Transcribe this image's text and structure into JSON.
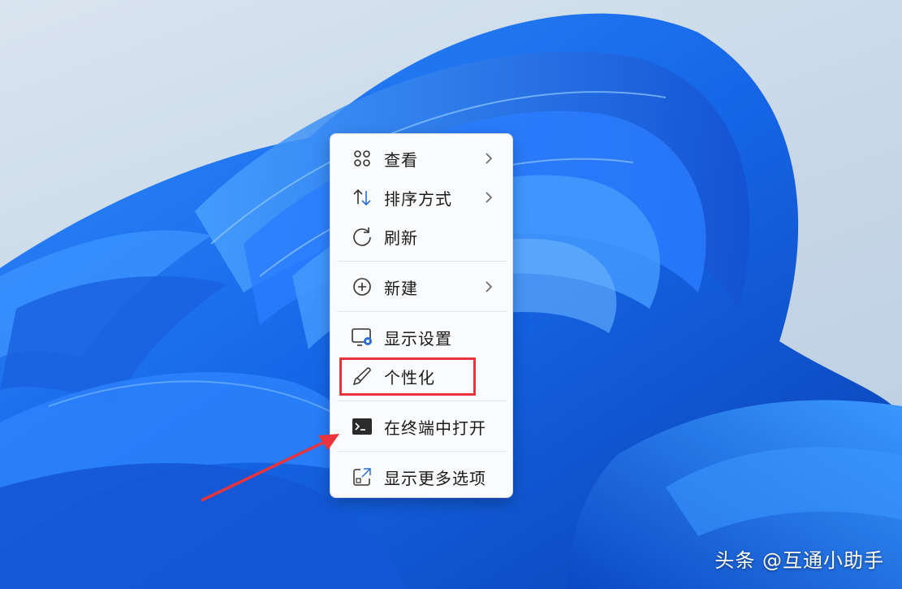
{
  "colors": {
    "accent_highlight": "#e8343a",
    "menu_background": "#fafbfc",
    "wallpaper_blue": "#1f6fe0"
  },
  "context_menu": {
    "items": [
      {
        "label": "查看",
        "icon": "view-grid-icon",
        "has_submenu": true
      },
      {
        "label": "排序方式",
        "icon": "sort-arrows-icon",
        "has_submenu": true
      },
      {
        "label": "刷新",
        "icon": "refresh-icon",
        "has_submenu": false
      },
      {
        "label": "新建",
        "icon": "new-plus-icon",
        "has_submenu": true
      },
      {
        "label": "显示设置",
        "icon": "display-settings-icon",
        "has_submenu": false
      },
      {
        "label": "个性化",
        "icon": "personalize-brush-icon",
        "has_submenu": false,
        "highlighted": true
      },
      {
        "label": "在终端中打开",
        "icon": "terminal-icon",
        "has_submenu": false
      },
      {
        "label": "显示更多选项",
        "icon": "more-options-icon",
        "has_submenu": false
      }
    ]
  },
  "watermark": {
    "text": "头条 @互通小助手"
  }
}
